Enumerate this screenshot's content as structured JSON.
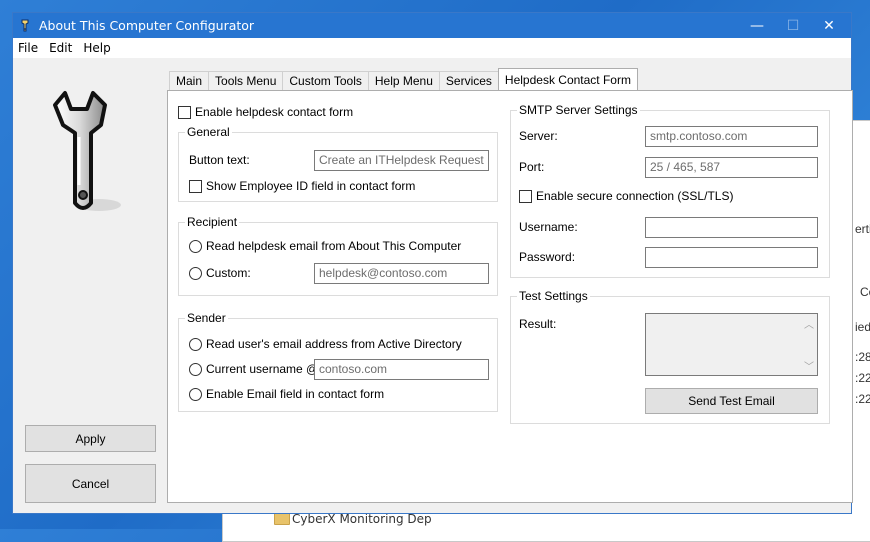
{
  "window": {
    "title": "About This Computer Configurator"
  },
  "menu": [
    "File",
    "Edit",
    "Help"
  ],
  "background": {
    "snippets": [
      "erti",
      "Co",
      "ied",
      ":28",
      ":22",
      ":22"
    ],
    "folder_label": "CyberX Monitoring Dep"
  },
  "buttons": {
    "apply": "Apply",
    "cancel": "Cancel",
    "send_test": "Send Test Email"
  },
  "tabs": [
    {
      "label": "Main",
      "active": false
    },
    {
      "label": "Tools Menu",
      "active": false
    },
    {
      "label": "Custom Tools",
      "active": false
    },
    {
      "label": "Help Menu",
      "active": false
    },
    {
      "label": "Services",
      "active": false
    },
    {
      "label": "Helpdesk Contact Form",
      "active": true
    }
  ],
  "form": {
    "enable_label": "Enable helpdesk contact form",
    "enable_checked": false,
    "general": {
      "legend": "General",
      "button_text_label": "Button text:",
      "button_text_placeholder": "Create an ITHelpdesk Request",
      "show_employee_label": "Show Employee ID field in contact form",
      "show_employee_checked": false
    },
    "recipient": {
      "legend": "Recipient",
      "read_label": "Read helpdesk email from About This Computer",
      "custom_label": "Custom:",
      "custom_placeholder": "helpdesk@contoso.com"
    },
    "sender": {
      "legend": "Sender",
      "read_ad_label": "Read user's email address from Active Directory",
      "current_user_label": "Current username @",
      "current_user_placeholder": "contoso.com",
      "enable_email_label": "Enable Email field in contact form"
    },
    "smtp": {
      "legend": "SMTP Server Settings",
      "server_label": "Server:",
      "server_placeholder": "smtp.contoso.com",
      "port_label": "Port:",
      "port_placeholder": "25 / 465, 587",
      "ssl_label": "Enable secure connection (SSL/TLS)",
      "ssl_checked": false,
      "username_label": "Username:",
      "username_value": "",
      "password_label": "Password:",
      "password_value": ""
    },
    "test": {
      "legend": "Test Settings",
      "result_label": "Result:",
      "result_value": ""
    }
  },
  "icons": {
    "window_controls": [
      "minimize-icon",
      "maximize-icon",
      "close-icon"
    ],
    "minimize_glyph": "—",
    "maximize_glyph": "☐",
    "close_glyph": "✕",
    "scroll_up_glyph": "︿",
    "scroll_down_glyph": "﹀"
  }
}
